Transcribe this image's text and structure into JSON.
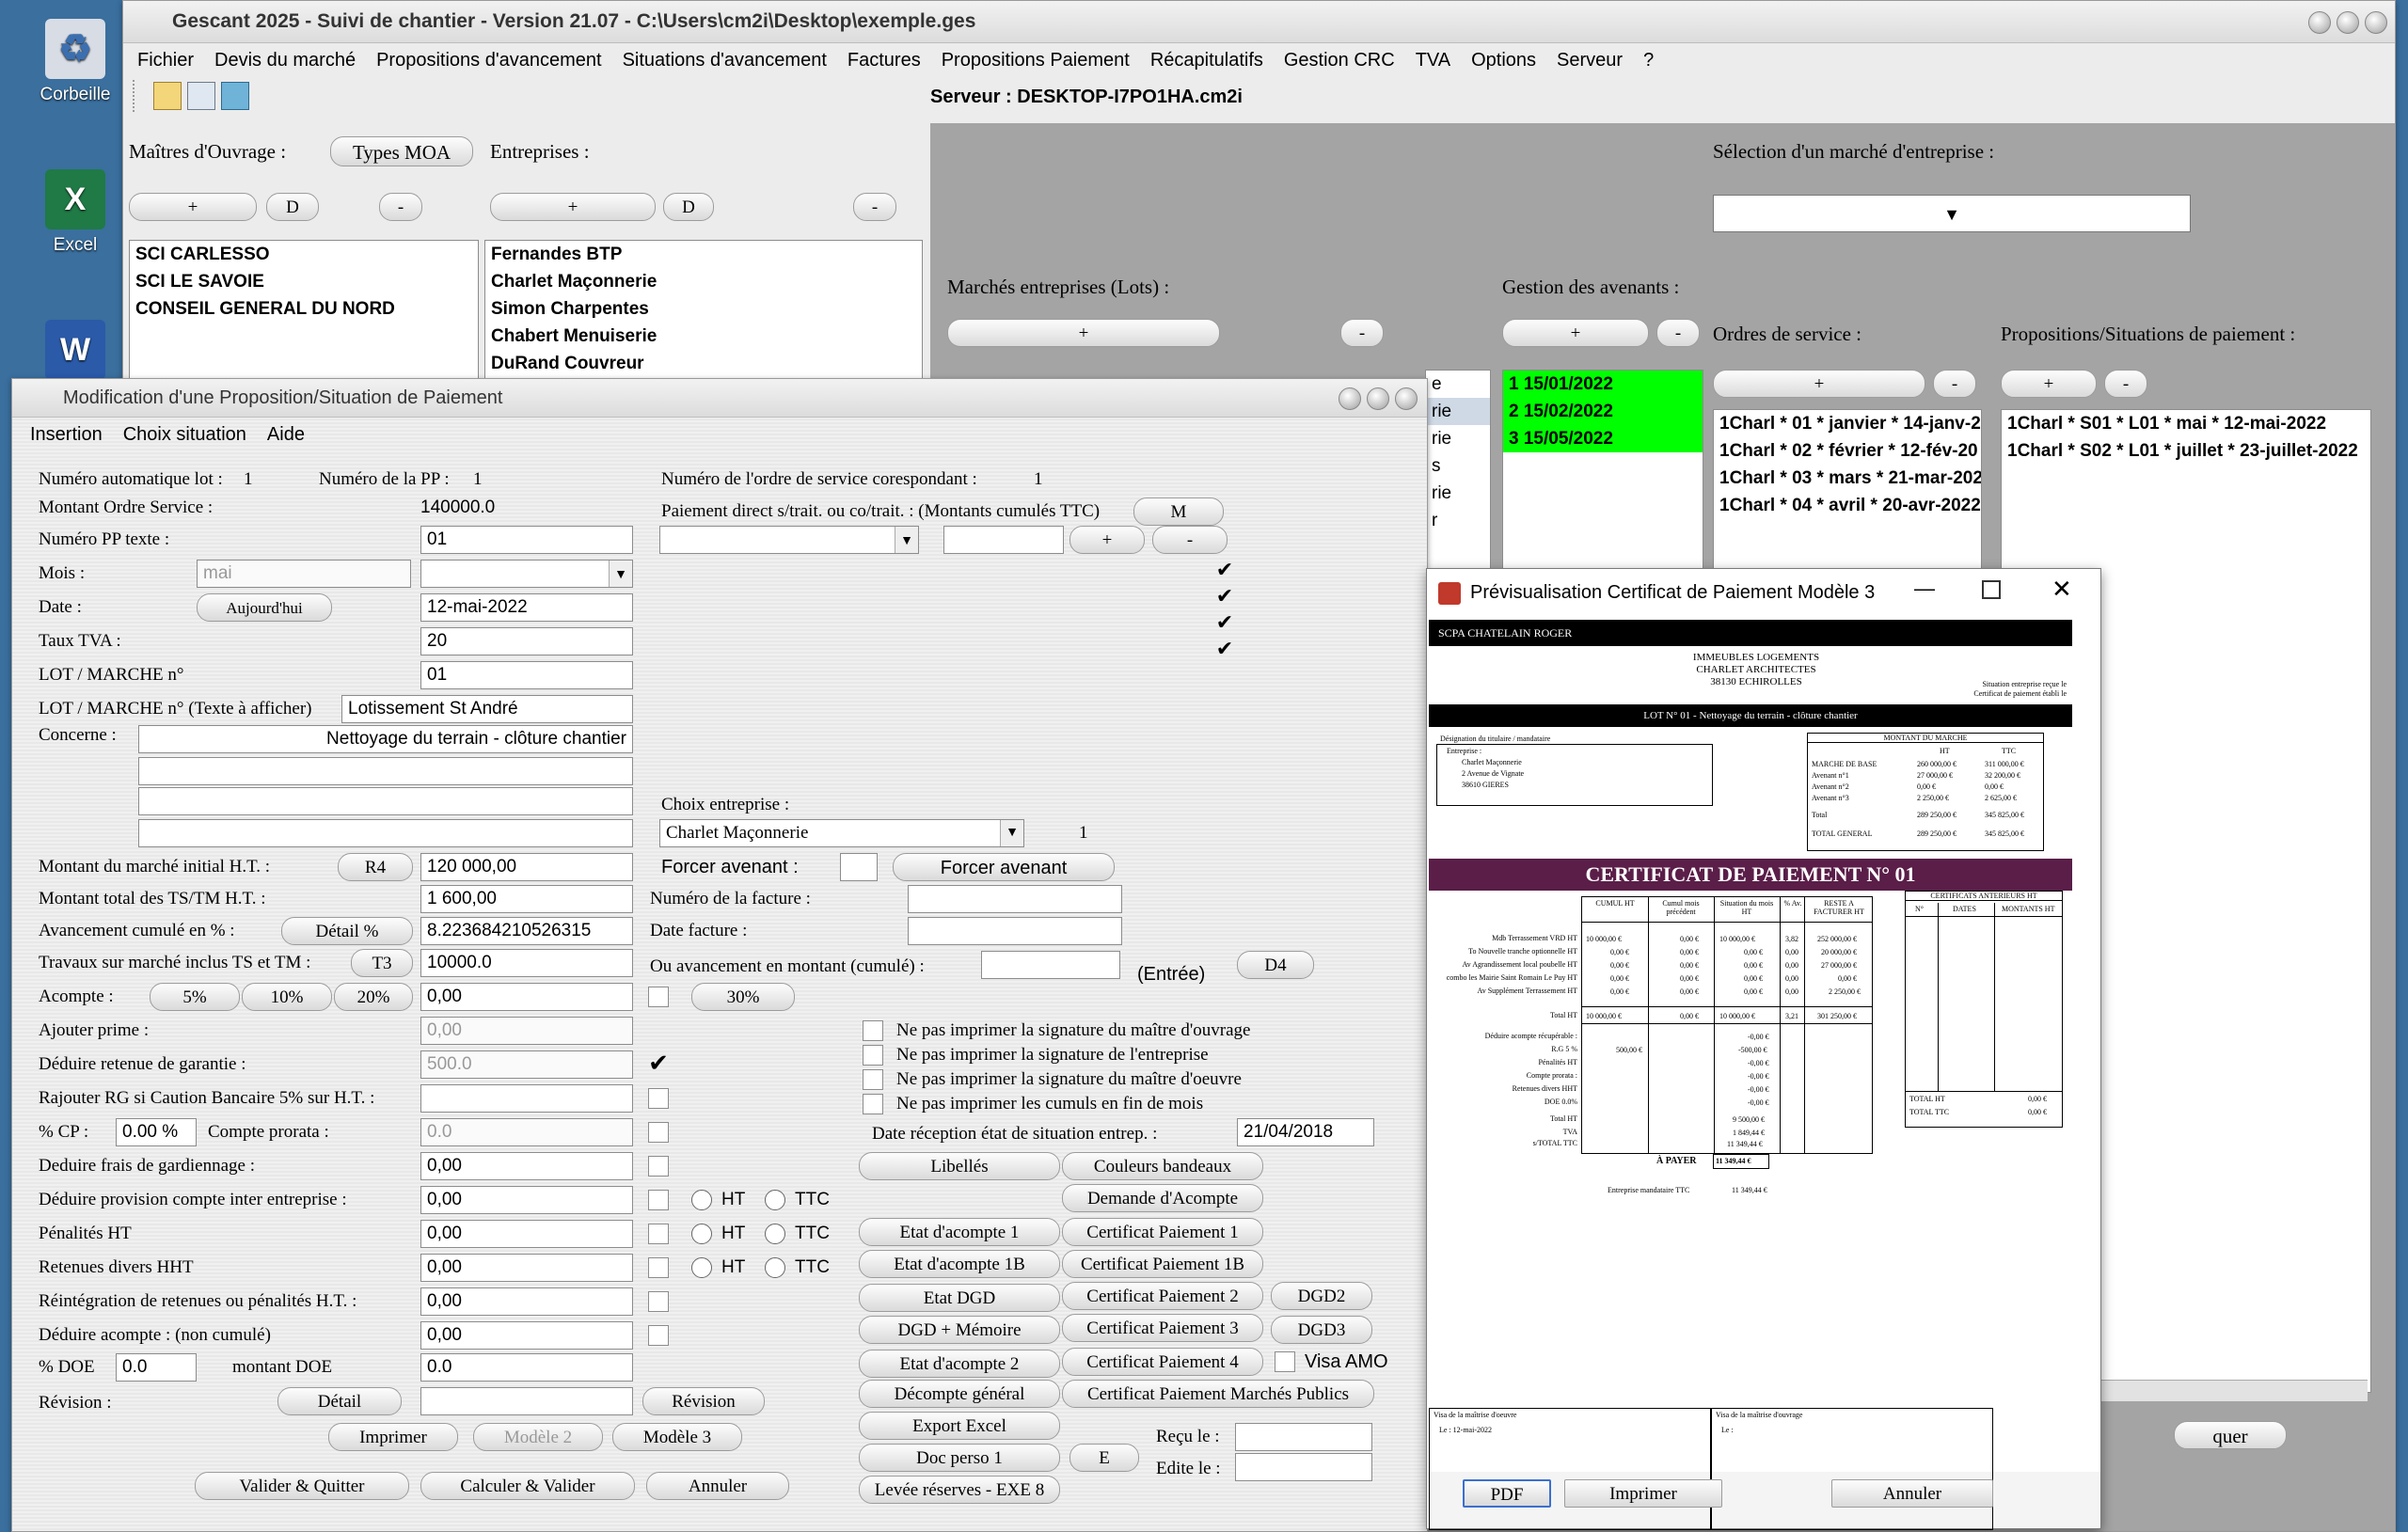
{
  "desktop": {
    "icons": [
      {
        "label": "Corbeille"
      },
      {
        "label": "Excel"
      },
      {
        "label": "W"
      }
    ]
  },
  "main_window": {
    "title": "Gescant 2025 - Suivi de chantier - Version 21.07 - C:\\Users\\cm2i\\Desktop\\exemple.ges",
    "menu": [
      "Fichier",
      "Devis du marché",
      "Propositions d'avancement",
      "Situations d'avancement",
      "Factures",
      "Propositions Paiement",
      "Récapitulatifs",
      "Gestion CRC",
      "TVA",
      "Options",
      "Serveur",
      "?"
    ],
    "server": "Serveur : DESKTOP-I7PO1HA.cm2i",
    "moa_label": "Maîtres d'Ouvrage :",
    "types_moa_btn": "Types MOA",
    "entreprises_label": "Entreprises :",
    "plus": "+",
    "d": "D",
    "minus": "-",
    "moa_list": [
      "SCI CARLESSO",
      "SCI LE SAVOIE",
      "CONSEIL GENERAL DU NORD"
    ],
    "entreprises_list": [
      "Fernandes BTP",
      "Charlet Maçonnerie",
      "Simon Charpentes",
      "Chabert Menuiserie",
      "DuRand Couvreur"
    ],
    "selection_marche_label": "Sélection d'un marché d'entreprise :",
    "dropdown_arrow": "▼",
    "marches_label": "Marchés entreprises (Lots) :",
    "marches_partial": [
      "e",
      "rie",
      "rie",
      "s",
      "rie",
      "r"
    ],
    "avenants_label": "Gestion des avenants :",
    "avenants_list": [
      "1 15/01/2022",
      "2 15/02/2022",
      "3 15/05/2022"
    ],
    "os_label": "Ordres de service :",
    "os_list": [
      "1Charl * 01 * janvier * 14-janv-2",
      "1Charl * 02 * février * 12-fév-20",
      "1Charl * 03 * mars * 21-mar-202",
      "1Charl * 04 * avril * 20-avr-2022"
    ],
    "pp_label": "Propositions/Situations de paiement :",
    "pp_list": [
      "1Charl * S01 * L01 * mai * 12-mai-2022",
      "1Charl * S02 * L01 * juillet * 23-juillet-2022"
    ],
    "quitter_partial": "quer",
    "accent_green": "#00ff00"
  },
  "modif_dialog": {
    "title": "Modification d'une Proposition/Situation de Paiement",
    "menu": [
      "Insertion",
      "Choix situation",
      "Aide"
    ],
    "num_auto_lot_label": "Numéro automatique lot :",
    "num_auto_lot": "1",
    "num_pp_label": "Numéro de la PP :",
    "num_pp": "1",
    "num_os_label": "Numéro de l'ordre de service corespondant :",
    "num_os": "1",
    "montant_os_label": "Montant Ordre Service :",
    "montant_os": "140000.0",
    "num_pp_texte_label": "Numéro PP texte :",
    "num_pp_texte": "01",
    "mois_label": "Mois :",
    "mois_value": "mai",
    "date_label": "Date :",
    "aujourdhui_btn": "Aujourd'hui",
    "date_value": "12-mai-2022",
    "taux_tva_label": "Taux TVA :",
    "taux_tva": "20",
    "lot_label": "LOT / MARCHE n°",
    "lot_value": "01",
    "lot_texte_label": "LOT / MARCHE n° (Texte à afficher)",
    "lot_texte": "Lotissement St André",
    "concerne_label": "Concerne :",
    "concerne_value": "Nettoyage du terrain - clôture chantier",
    "paiement_direct_label": "Paiement direct s/trait. ou co/trait. : (Montants cumulés TTC)",
    "m_btn": "M",
    "choix_entreprise_label": "Choix entreprise :",
    "choix_entreprise": "Charlet Maçonnerie",
    "choix_entreprise_num": "1",
    "montant_initial_label": "Montant du marché initial H.T. :",
    "r4_btn": "R4",
    "montant_initial": "120 000,00",
    "forcer_avenant_label": "Forcer avenant :",
    "forcer_avenant_btn": "Forcer avenant",
    "montant_ts_label": "Montant total des TS/TM H.T. :",
    "montant_ts": "1 600,00",
    "num_facture_label": "Numéro de la facture :",
    "avancement_label": "Avancement cumulé en % :",
    "detail_pct_btn": "Détail %",
    "avancement": "8.223684210526315",
    "date_facture_label": "Date facture :",
    "travaux_label": "Travaux sur marché inclus TS et TM :",
    "t3_btn": "T3",
    "travaux": "10000.0",
    "ou_avancement_label": "Ou avancement en montant (cumulé) :",
    "entree": "(Entrée)",
    "d4_btn": "D4",
    "acompte_label": "Acompte :",
    "pct5": "5%",
    "pct10": "10%",
    "pct20": "20%",
    "pct30": "30%",
    "acompte": "0,00",
    "ajouter_prime_label": "Ajouter prime :",
    "ajouter_prime": "0,00",
    "deduire_rg_label": "Déduire retenue de garantie :",
    "deduire_rg": "500.0",
    "rajouter_rg_label": "Rajouter RG si Caution Bancaire 5% sur H.T. :",
    "cp_label": "% CP :",
    "cp_value": "0.00 %",
    "compte_prorata_label": "Compte prorata :",
    "compte_prorata": "0.0",
    "gardiennage_label": "Deduire frais de gardiennage :",
    "gardiennage": "0,00",
    "provision_label": "Déduire provision compte inter entreprise :",
    "provision": "0,00",
    "penalites_label": "Pénalités HT",
    "penalites": "0,00",
    "retenues_label": "Retenues divers HHT",
    "retenues": "0,00",
    "reintegration_label": "Réintégration de retenues ou pénalités H.T. :",
    "reintegration": "0,00",
    "deduire_acompte_label": "Déduire acompte : (non cumulé)",
    "deduire_acompte": "0,00",
    "doe_label": "% DOE",
    "doe_pct": "0.0",
    "montant_doe_label": "montant DOE",
    "montant_doe": "0.0",
    "revision_label": "Révision :",
    "detail_btn": "Détail",
    "revision_btn": "Révision",
    "imprimer_btn": "Imprimer",
    "modele2_btn": "Modèle 2",
    "modele3_btn": "Modèle 3",
    "valider_quitter_btn": "Valider & Quitter",
    "calculer_valider_btn": "Calculer & Valider",
    "annuler_btn": "Annuler",
    "ht": "HT",
    "ttc": "TTC",
    "sig_moa": "Ne pas imprimer la signature du maître d'ouvrage",
    "sig_ent": "Ne pas imprimer la signature de l'entreprise",
    "sig_moe": "Ne pas imprimer la signature du maître d'oeuvre",
    "cumuls": "Ne pas imprimer les cumuls en fin de mois",
    "date_reception_label": "Date réception état de situation entrep. :",
    "date_reception": "21/04/2018",
    "right_buttons": {
      "libelles": "Libellés",
      "couleurs": "Couleurs bandeaux",
      "demande_acompte": "Demande d'Acompte",
      "etat_acompte1": "Etat d'acompte 1",
      "cert1": "Certificat Paiement 1",
      "etat_acompte1b": "Etat d'acompte 1B",
      "cert1b": "Certificat Paiement 1B",
      "etat_dgd": "Etat DGD",
      "cert2": "Certificat Paiement 2",
      "dgd2": "DGD2",
      "dgd_memoire": "DGD + Mémoire",
      "cert3": "Certificat Paiement 3",
      "dgd3": "DGD3",
      "etat_acompte2": "Etat d'acompte 2",
      "cert4": "Certificat Paiement 4",
      "visa_amo": "Visa AMO",
      "decompte": "Décompte général",
      "cert_mp": "Certificat Paiement Marchés Publics",
      "export_excel": "Export Excel",
      "doc_perso": "Doc perso 1",
      "e": "E",
      "recu_le": "Reçu le :",
      "edite_le": "Edite le :",
      "levee": "Levée réserves - EXE 8"
    }
  },
  "preview": {
    "title": "Prévisualisation Certificat de Paiement Modèle 3",
    "header_bar": "SCPA CHATELAIN ROGER",
    "client_lines": [
      "IMMEUBLES LOGEMENTS",
      "CHARLET ARCHITECTES",
      "38130 ECHIROLLES"
    ],
    "right_note": [
      "Situation entreprise reçue le",
      "Certificat de paiement établi le"
    ],
    "lot_bar": "LOT N° 01 - Nettoyage du terrain - clôture chantier",
    "designation_title": "Désignation du titulaire / mandataire",
    "designation_lines": [
      "Entreprise :",
      "Charlet Maçonnerie",
      "2 Avenue de Vignate",
      "38610 GIERES"
    ],
    "montant_title": "MONTANT DU MARCHE",
    "montant_head": [
      "",
      "HT",
      "TTC"
    ],
    "montant_rows": [
      [
        "MARCHE DE BASE",
        "260 000,00 €",
        "311 000,00 €"
      ],
      [
        "Avenant n°1",
        "27 000,00 €",
        "32 200,00 €"
      ],
      [
        "Avenant n°2",
        "0,00 €",
        "0,00 €"
      ],
      [
        "Avenant n°3",
        "2 250,00 €",
        "2 625,00 €"
      ],
      [
        "Total",
        "289 250,00 €",
        "345 825,00 €"
      ],
      [
        "TOTAL GENERAL",
        "289 250,00 €",
        "345 825,00 €"
      ]
    ],
    "cert_title": "CERTIFICAT DE PAIEMENT N° 01",
    "table_head": [
      "CUMUL HT",
      "Cumul mois précédent",
      "Situation du mois HT",
      "% Av.",
      "RESTE A FACTURER HT"
    ],
    "table_rows": [
      [
        "Mdb Terrassement VRD HT",
        "10 000,00 €",
        "0,00 €",
        "10 000,00 €",
        "3,82",
        "252 000,00 €"
      ],
      [
        "To Nouvelle tranche optionnelle HT",
        "0,00 €",
        "0,00 €",
        "0,00 €",
        "0,00",
        "20 000,00 €"
      ],
      [
        "Av Agrandissement local poubelle HT",
        "0,00 €",
        "0,00 €",
        "0,00 €",
        "0,00",
        "27 000,00 €"
      ],
      [
        "combo les Mairie Saint Romain Le Puy HT",
        "0,00 €",
        "0,00 €",
        "0,00 €",
        "0,00",
        "0,00 €"
      ],
      [
        "Av Supplément Terrassement HT",
        "0,00 €",
        "0,00 €",
        "0,00 €",
        "0,00",
        "2 250,00 €"
      ]
    ],
    "total_ht_row": [
      "Total HT",
      "10 000,00 €",
      "0,00 €",
      "10 000,00 €",
      "3,21",
      "301 250,00 €"
    ],
    "deductions": [
      [
        "Déduire acompte récupérable :",
        "",
        "-0,00 €"
      ],
      [
        "R.G 5 %",
        "500,00 €",
        "-500,00 €"
      ],
      [
        "Pénalités HT",
        "",
        "-0,00 €"
      ],
      [
        "Compte prorata :",
        "",
        "-0,00 €"
      ],
      [
        "Retenues divers HHT",
        "",
        "-0,00 €"
      ],
      [
        "DOE 0.0%",
        "",
        "-0,00 €"
      ]
    ],
    "totals": [
      [
        "Total HT",
        "9 500,00 €"
      ],
      [
        "TVA",
        "1 849,44 €"
      ],
      [
        "s/TOTAL TTC",
        "11 349,44 €"
      ]
    ],
    "a_payer_label": "À PAYER",
    "a_payer": "11 349,44 €",
    "mandataire_label": "Entreprise mandataire TTC",
    "mandataire": "11 349,44 €",
    "cert_ant_title": "CERTIFICATS ANTERIEURS HT",
    "cert_ant_head": [
      "N°",
      "DATES",
      "MONTANTS HT"
    ],
    "cert_ant_totals": [
      [
        "TOTAL HT",
        "0,00 €"
      ],
      [
        "TOTAL TTC",
        "0,00 €"
      ]
    ],
    "visa_moe": "Visa de la maîtrise d'oeuvre",
    "visa_moe_date": "Le : 12-mai-2022",
    "visa_moa": "Visa de la maîtrise d'ouvrage",
    "visa_moa_date": "Le :",
    "pdf_btn": "PDF",
    "imprimer_btn": "Imprimer",
    "annuler_btn": "Annuler",
    "accent_purple": "#5a1e48"
  }
}
